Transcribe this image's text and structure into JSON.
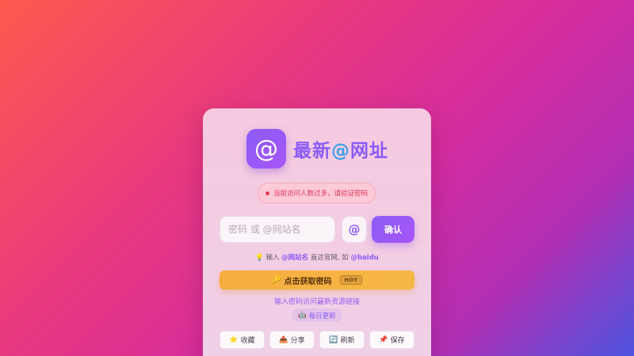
{
  "brand": {
    "logo_symbol": "@",
    "title_part1": "最新",
    "title_at": "@",
    "title_part2": "网址",
    "accent": "#8b5cf6"
  },
  "alert": {
    "text": "当前访问人数过多，请验证密码",
    "color": "#e53950"
  },
  "search": {
    "placeholder": "密码 或 @网站名",
    "value": "",
    "at_button": "@",
    "confirm_label": "确认"
  },
  "hint": {
    "icon": "💡",
    "prefix": "输入",
    "keyword": "@网站名",
    "middle": "直达官网, 如",
    "example": "@baidu"
  },
  "get_password": {
    "icon": "🔑",
    "label": "点击获取密码",
    "badge": "HOT"
  },
  "sub_link": "输入密码访问最新资源链接",
  "daily": {
    "icon": "🤖",
    "label": "每日更新"
  },
  "actions": [
    {
      "icon": "⭐",
      "label": "收藏"
    },
    {
      "icon": "📤",
      "label": "分享"
    },
    {
      "icon": "🔄",
      "label": "刷新"
    },
    {
      "icon": "📌",
      "label": "保存"
    }
  ]
}
